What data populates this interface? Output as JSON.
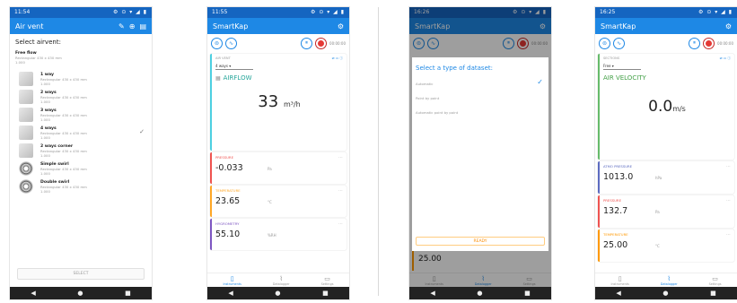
{
  "phone1": {
    "status_time": "11:54",
    "status_icons": "⚙ ⊙ ▾ ◢ ▮",
    "appbar_title": "Air vent",
    "select_label": "Select airvent:",
    "first_item": {
      "name": "Free flow",
      "sub1": "Rectangular 430 x 430 mm",
      "sub2": "1.000"
    },
    "items": [
      {
        "name": "1 way",
        "sub1": "Rectangular 430 x 430 mm",
        "sub2": "1.000"
      },
      {
        "name": "2 ways",
        "sub1": "Rectangular 430 x 430 mm",
        "sub2": "1.000"
      },
      {
        "name": "3 ways",
        "sub1": "Rectangular 430 x 430 mm",
        "sub2": "1.000"
      },
      {
        "name": "4 ways",
        "sub1": "Rectangular 430 x 430 mm",
        "sub2": "1.000"
      },
      {
        "name": "2 ways corner",
        "sub1": "Rectangular 430 x 430 mm",
        "sub2": "1.000"
      },
      {
        "name": "Simple swirl",
        "sub1": "Rectangular 430 x 430 mm",
        "sub2": "1.000"
      },
      {
        "name": "Double swirl",
        "sub1": "Rectangular 430 x 430 mm",
        "sub2": "1.000"
      }
    ],
    "checked_item": "✓",
    "select_button": "SELECT",
    "nav": [
      "◀",
      "●",
      "■"
    ]
  },
  "phone2": {
    "status_time": "11:55",
    "status_icons": "⚙ ⊙ ▾ ◢ ▮",
    "appbar_title": "SmartKap",
    "tool_text": "00:00:00",
    "main_card": {
      "top_label": "AIR VENT",
      "select": "4 ways",
      "title": "AIRFLOW",
      "value": "33",
      "unit": "m³/h"
    },
    "cards": [
      {
        "label": "PRESSURE",
        "value": "-0.033",
        "unit": "Pa",
        "color": "#ef5350"
      },
      {
        "label": "TEMPERATURE",
        "value": "23.65",
        "unit": "°C",
        "color": "#ffa726"
      },
      {
        "label": "HYGROMETRY",
        "value": "55.10",
        "unit": "%RH",
        "color": "#7e57c2"
      }
    ],
    "tabs": [
      "Instruments",
      "Datalogger",
      "Settings"
    ],
    "nav": [
      "◀",
      "●",
      "■"
    ]
  },
  "phone3": {
    "status_time": "16:26",
    "status_icons": "⚙ ⊙ ▾ ◢ ▮",
    "appbar_title": "SmartKap",
    "tool_text": "00:00:00",
    "dialog_title": "Select a type of dataset:",
    "options": [
      "Automatic",
      "Point by point",
      "Automatic point by point"
    ],
    "check": "✓",
    "ready_button": "READY",
    "under_value": "25.00",
    "tabs": [
      "Instruments",
      "Datalogger",
      "Settings"
    ],
    "nav": [
      "◀",
      "●",
      "■"
    ]
  },
  "phone4": {
    "status_time": "16:25",
    "status_icons": "⚙ ⊙ ▾ ◢ ▮",
    "appbar_title": "SmartKap",
    "tool_text": "00:00:00",
    "main_card": {
      "top_label": "SECTIONS",
      "select": "Free",
      "title": "AIR VELOCITY",
      "value": "0.0",
      "unit": "m/s"
    },
    "cards": [
      {
        "label": "ATMO PRESSURE",
        "value": "1013.0",
        "unit": "hPa",
        "color": "#5c6bc0"
      },
      {
        "label": "PRESSURE",
        "value": "132.7",
        "unit": "Pa",
        "color": "#ef5350"
      },
      {
        "label": "TEMPERATURE",
        "value": "25.00",
        "unit": "°C",
        "color": "#ff9800"
      }
    ],
    "tabs": [
      "Instruments",
      "Datalogger",
      "Settings"
    ],
    "nav": [
      "◀",
      "●",
      "■"
    ]
  }
}
